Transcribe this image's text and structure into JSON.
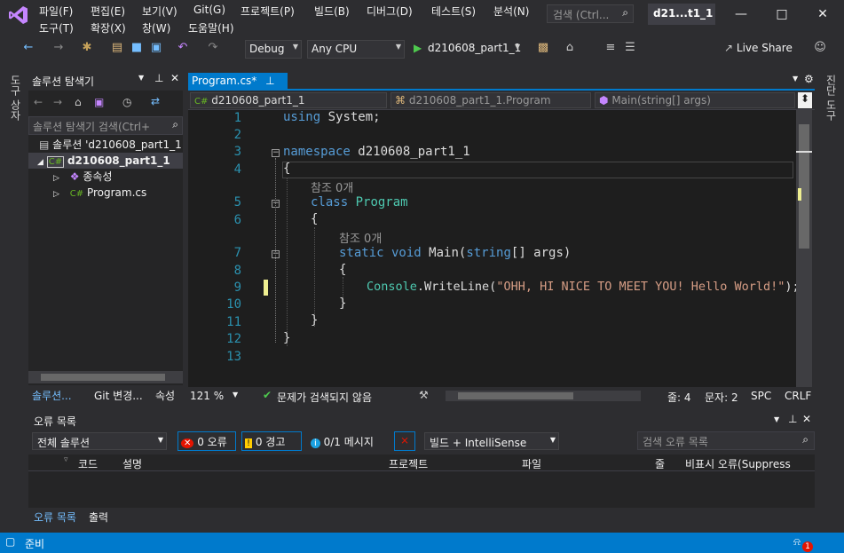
{
  "menu": {
    "row1": [
      "파일(F)",
      "편집(E)",
      "보기(V)",
      "Git(G)",
      "프로젝트(P)",
      "빌드(B)",
      "디버그(D)",
      "테스트(S)",
      "분석(N)"
    ],
    "row2": [
      "도구(T)",
      "확장(X)",
      "창(W)",
      "도움말(H)"
    ],
    "search_placeholder": "검색 (Ctrl...",
    "window_title": "d21...t1_1"
  },
  "toolbar": {
    "config": "Debug",
    "platform": "Any CPU",
    "run_target": "d210608_part1_1",
    "live_share": "Live Share"
  },
  "side_strips": {
    "left": "도구 상자",
    "right": "진단 도구"
  },
  "solution_explorer": {
    "title": "솔루션 탐색기",
    "search_placeholder": "솔루션 탐색기 검색(Ctrl+",
    "tree": [
      {
        "label": "솔루션 'd210608_part1_1",
        "icon": "solution-icon"
      },
      {
        "label": "d210608_part1_1",
        "icon": "csharp-project-icon"
      },
      {
        "label": "종속성",
        "icon": "dependencies-icon"
      },
      {
        "label": "Program.cs",
        "icon": "csharp-file-icon"
      }
    ],
    "tabs": [
      "솔루션...",
      "Git 변경...",
      "속성"
    ]
  },
  "editor": {
    "tab_label": "Program.cs*",
    "nav_project": "d210608_part1_1",
    "nav_class": "d210608_part1_1.Program",
    "nav_member": "Main(string[] args)",
    "line_numbers": [
      "1",
      "2",
      "3",
      "4",
      "5",
      "6",
      "7",
      "8",
      "9",
      "10",
      "11",
      "12",
      "13"
    ],
    "code": {
      "l1a": "using",
      "l1b": " System;",
      "l3a": "namespace",
      "l3b": " d210608_part1_1",
      "l4": "{",
      "ref1": "참조 0개",
      "l5a": "class",
      "l5b": " Program",
      "l6": "{",
      "ref2": "참조 0개",
      "l7a": "static",
      "l7b": " void",
      "l7c": " Main(",
      "l7d": "string",
      "l7e": "[] args)",
      "l8": "{",
      "l9a": "Console",
      "l9b": ".WriteLine(",
      "l9c": "\"OHH, HI NICE TO MEET YOU! Hello World!\"",
      "l9d": ");",
      "l10": "}",
      "l11": "}",
      "l12": "}"
    },
    "zoom": "121 %",
    "issues": "문제가 검색되지 않음",
    "line": "줄: 4",
    "col": "문자: 2",
    "spc": "SPC",
    "crlf": "CRLF"
  },
  "error_list": {
    "title": "오류 목록",
    "scope": "전체 솔루션",
    "errors": "0 오류",
    "warnings": "0 경고",
    "messages": "0/1 메시지",
    "build_filter": "빌드 + IntelliSense",
    "search_placeholder": "검색 오류 목록",
    "columns": [
      "코드",
      "설명",
      "프로젝트",
      "파일",
      "줄",
      "비표시 오류(Suppress"
    ],
    "tabs": [
      "오류 목록",
      "출력"
    ]
  },
  "statusbar": {
    "ready": "준비",
    "notifications": "1"
  },
  "colors": {
    "accent": "#007acc",
    "editor_bg": "#1e1e1e",
    "keyword": "#569cd6",
    "type": "#4ec9b0",
    "string": "#d69d85"
  }
}
